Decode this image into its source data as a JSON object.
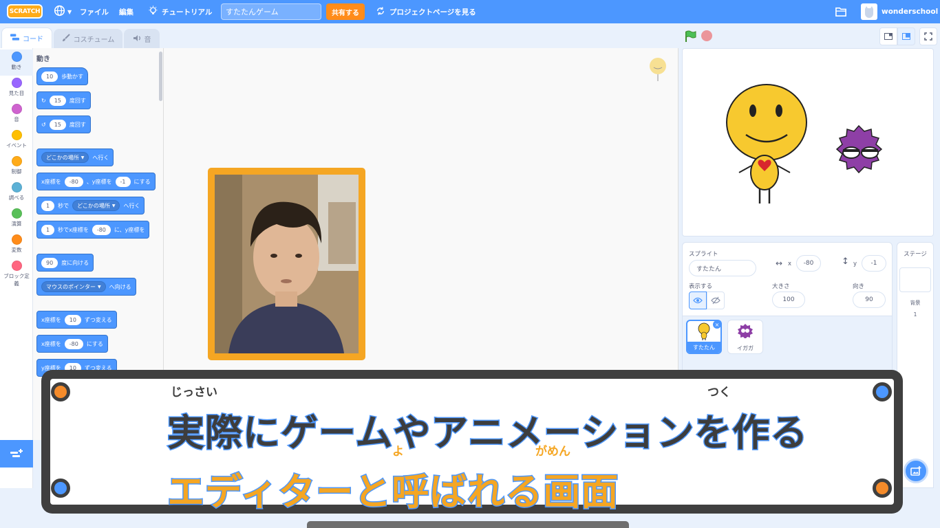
{
  "topbar": {
    "logo": "SCRATCH",
    "menu_file": "ファイル",
    "menu_edit": "編集",
    "tutorials": "チュートリアル",
    "project_title": "すたたんゲーム",
    "share": "共有する",
    "see_project_page": "プロジェクトページを見る",
    "username": "wonderschool"
  },
  "tabs": {
    "code": "コード",
    "costumes": "コスチューム",
    "sounds": "音"
  },
  "categories": [
    {
      "label": "動き",
      "color": "#4c97ff"
    },
    {
      "label": "見た目",
      "color": "#9966ff"
    },
    {
      "label": "音",
      "color": "#cf63cf"
    },
    {
      "label": "イベント",
      "color": "#ffbf00"
    },
    {
      "label": "制御",
      "color": "#ffab19"
    },
    {
      "label": "調べる",
      "color": "#5cb1d6"
    },
    {
      "label": "演算",
      "color": "#59c059"
    },
    {
      "label": "変数",
      "color": "#ff8c1a"
    },
    {
      "label": "ブロック定義",
      "color": "#ff6680"
    }
  ],
  "palette": {
    "heading": "動き",
    "blocks": {
      "move": {
        "v": "10",
        "t": "歩動かす"
      },
      "turn_right": {
        "v": "15",
        "t": "度回す"
      },
      "turn_left": {
        "v": "15",
        "t": "度回す"
      },
      "goto": {
        "dd": "どこかの場所",
        "t": "へ行く"
      },
      "gotoxy": {
        "t1": "x座標を",
        "x": "-80",
        "t2": "、y座標を",
        "y": "-1",
        "t3": "にする"
      },
      "glide_to": {
        "v": "1",
        "t1": "秒で",
        "dd": "どこかの場所",
        "t2": "へ行く"
      },
      "glide_xy": {
        "v": "1",
        "t1": "秒でx座標を",
        "x": "-80",
        "t2": "に、y座標を"
      },
      "point_dir": {
        "v": "90",
        "t": "度に向ける"
      },
      "point_towards": {
        "dd": "マウスのポインター",
        "t": "へ向ける"
      },
      "change_x": {
        "t1": "x座標を",
        "v": "10",
        "t2": "ずつ変える"
      },
      "set_x": {
        "t1": "x座標を",
        "v": "-80",
        "t2": "にする"
      },
      "change_y": {
        "t1": "y座標を",
        "v": "10",
        "t2": "ずつ変える"
      }
    }
  },
  "sprite_info": {
    "sprite_label": "スプライト",
    "sprite_name": "すたたん",
    "x_label": "x",
    "x": "-80",
    "y_label": "y",
    "y": "-1",
    "show_label": "表示する",
    "size_label": "大きさ",
    "size": "100",
    "direction_label": "向き",
    "direction": "90"
  },
  "sprites": [
    {
      "name": "すたたん"
    },
    {
      "name": "イガガ"
    }
  ],
  "stage_pane": {
    "title": "ステージ",
    "backdrops_label": "背景",
    "backdrops_count": "1"
  },
  "caption": {
    "line1": "実際にゲームやアニメーションを作る",
    "line1_ruby_a": "じっさい",
    "line1_ruby_b": "つく",
    "line2": "エディターと呼ばれる画面",
    "line2_ruby_a": "よ",
    "line2_ruby_b": "がめん"
  },
  "colors": {
    "accent": "#4c97ff",
    "share": "#ff8c1a",
    "caption_orange": "#f5a623",
    "screw_orange": "#f58b2a",
    "screw_blue": "#4c97ff"
  }
}
